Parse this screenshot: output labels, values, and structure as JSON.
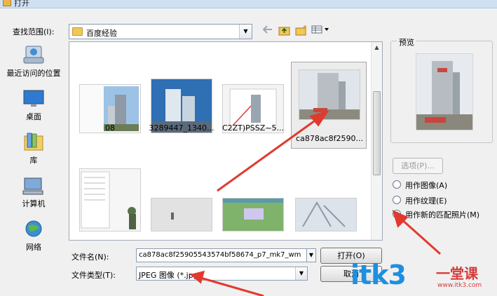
{
  "window": {
    "title": "打开"
  },
  "lookin": {
    "label": "查找范围(I):",
    "value": "百度经验"
  },
  "places": [
    {
      "label": "最近访问的位置"
    },
    {
      "label": "桌面"
    },
    {
      "label": "库"
    },
    {
      "label": "计算机"
    },
    {
      "label": "网络"
    }
  ],
  "files": [
    {
      "name": "08"
    },
    {
      "name": "3289447_1340..."
    },
    {
      "name": "C2ZT)PSSZ~5..."
    },
    {
      "name": "ca878ac8f2590..."
    },
    {
      "name": ""
    },
    {
      "name": ""
    },
    {
      "name": ""
    },
    {
      "name": ""
    }
  ],
  "filename": {
    "label": "文件名(N):",
    "value": "ca878ac8f25905543574bf58674_p7_mk7_wm"
  },
  "filetype": {
    "label": "文件类型(T):",
    "value": "JPEG 图像 (*.jpg)"
  },
  "buttons": {
    "open": "打开(O)",
    "cancel": "取消",
    "options": "选项(P)..."
  },
  "preview": {
    "label": "预览"
  },
  "radios": [
    {
      "label": "用作图像(A)",
      "checked": false
    },
    {
      "label": "用作纹理(E)",
      "checked": false
    },
    {
      "label": "用作新的匹配照片(M)",
      "checked": true
    }
  ],
  "watermark": {
    "logo": "itk3",
    "cn": "一堂课",
    "url": "www.itk3.com"
  },
  "colors": {
    "arrow": "#e2392f",
    "selection": "#ececec",
    "accent": "#1d8fe0"
  }
}
